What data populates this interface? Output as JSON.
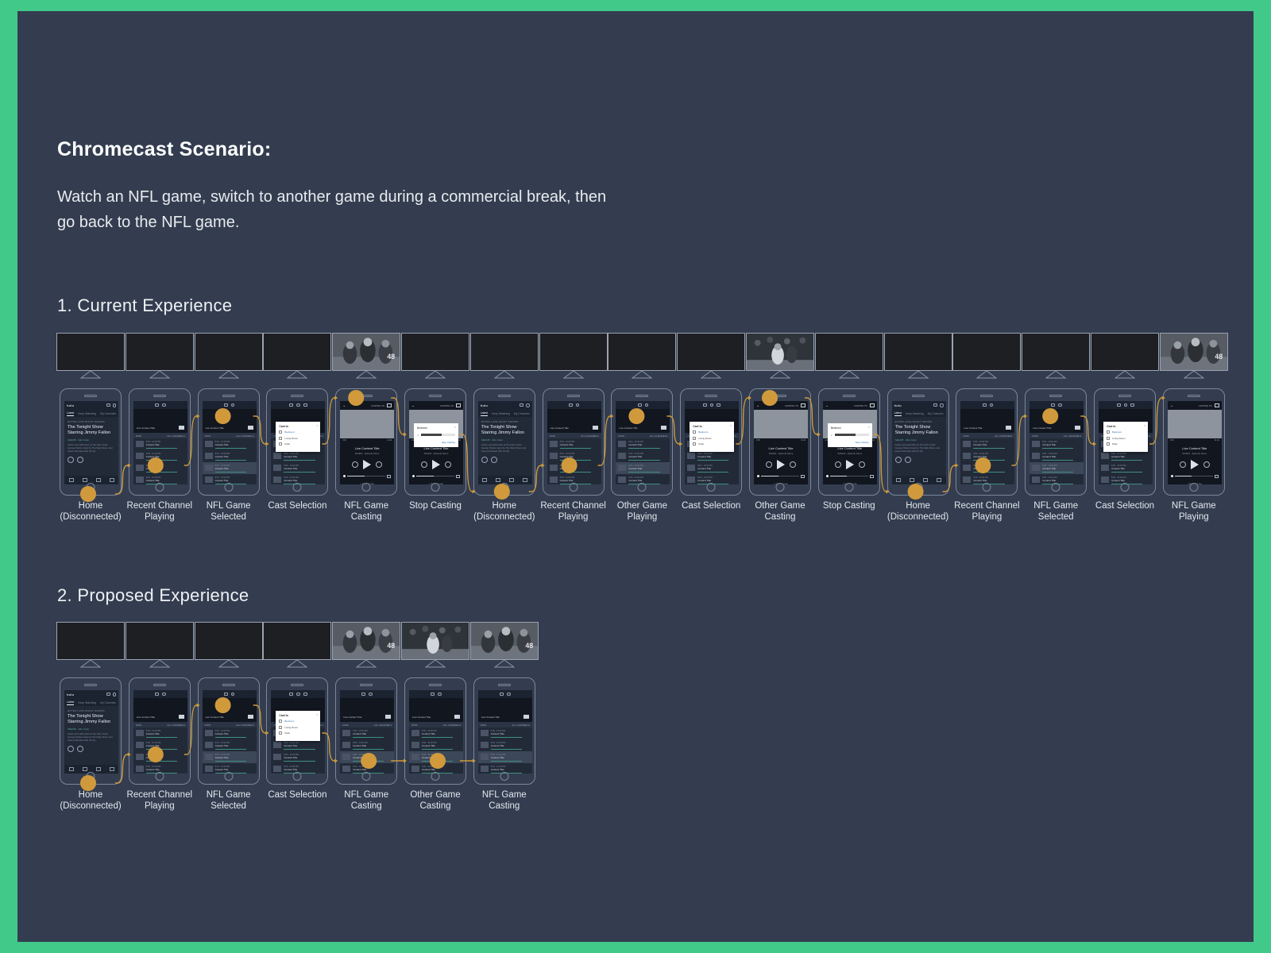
{
  "theme": {
    "frame_color": "#41c98a",
    "background": "#333d4f",
    "accent": "#d09a3c",
    "text": "#e3e8ef",
    "tv_screen": "#1e1f23",
    "device_outline": "#7b879a"
  },
  "header": {
    "title": "Chromecast Scenario:",
    "description": "Watch an NFL game, switch to  another game during a commercial break, then go back to the NFL game."
  },
  "sections": [
    {
      "heading": "1. Current Experience",
      "steps": [
        {
          "caption": "Home\n(Disconnected)",
          "tv": "off",
          "screen": "hulu-home"
        },
        {
          "caption": "Recent Channel\nPlaying",
          "tv": "off",
          "screen": "channel-list"
        },
        {
          "caption": "NFL Game\nSelected",
          "tv": "off",
          "screen": "channel-list-hl"
        },
        {
          "caption": "Cast Selection",
          "tv": "off",
          "screen": "cast-modal"
        },
        {
          "caption": "NFL Game\nCasting",
          "tv": "nfl",
          "screen": "player"
        },
        {
          "caption": "Stop Casting",
          "tv": "off",
          "screen": "stop-modal"
        },
        {
          "caption": "Home\n(Disconnected)",
          "tv": "off",
          "screen": "hulu-home"
        },
        {
          "caption": "Recent Channel\nPlaying",
          "tv": "off",
          "screen": "channel-list"
        },
        {
          "caption": "Other Game\nPlaying",
          "tv": "off",
          "screen": "channel-list-hl"
        },
        {
          "caption": "Cast Selection",
          "tv": "off",
          "screen": "cast-modal"
        },
        {
          "caption": "Other Game\nCasting",
          "tv": "bball",
          "screen": "player"
        },
        {
          "caption": "Stop Casting",
          "tv": "off",
          "screen": "stop-modal"
        },
        {
          "caption": "Home\n(Disconnected)",
          "tv": "off",
          "screen": "hulu-home"
        },
        {
          "caption": "Recent Channel\nPlaying",
          "tv": "off",
          "screen": "channel-list"
        },
        {
          "caption": "NFL Game\nSelected",
          "tv": "off",
          "screen": "channel-list-hl"
        },
        {
          "caption": "Cast Selection",
          "tv": "off",
          "screen": "cast-modal"
        },
        {
          "caption": "NFL Game\nPlaying",
          "tv": "nfl",
          "screen": "player"
        }
      ]
    },
    {
      "heading": "2. Proposed Experience",
      "steps": [
        {
          "caption": "Home\n(Disconnected)",
          "tv": "off",
          "screen": "hulu-home"
        },
        {
          "caption": "Recent Channel\nPlaying",
          "tv": "off",
          "screen": "channel-list"
        },
        {
          "caption": "NFL Game\nSelected",
          "tv": "off",
          "screen": "channel-list-hl"
        },
        {
          "caption": "Cast Selection",
          "tv": "off",
          "screen": "cast-modal"
        },
        {
          "caption": "NFL Game\nCasting",
          "tv": "nfl",
          "screen": "channel-list-hl"
        },
        {
          "caption": "Other Game\nCasting",
          "tv": "bball",
          "screen": "channel-list-hl"
        },
        {
          "caption": "NFL Game\nCasting",
          "tv": "nfl",
          "screen": "channel-list-hl"
        }
      ]
    }
  ],
  "phone_screens": {
    "hulu_home": {
      "logo": "hulu",
      "tabs": [
        "Latest",
        "Keep Watching",
        "My Channels"
      ],
      "kicker": "EXTRA LATE NIGHT SHOWS",
      "title": "The Tonight Show Starring Jimmy Fallon",
      "meta": "S2E135 · 44m Color",
      "description": "Author and staff writer at The New Yorker George Packer stops by The Daily Show, and travel enthusiast with his trip."
    },
    "channel_list": {
      "now_label": "NOW",
      "all_channels_label": "ALL CHANNELS",
      "pip_title": "Live Content Title",
      "row_time": "8:00 - 10:30 PM",
      "row_title": "Content Title"
    },
    "player": {
      "back_icon": "chevron-down-icon",
      "casting_to": "CASTING TO",
      "title": "Live Content Title",
      "subtitle": "S01E01 - Episode Name",
      "jump_label": "Jump to Live",
      "time_start": "0:00",
      "time_end": "11:44"
    },
    "cast_modal": {
      "title": "Cast to",
      "options": [
        "Bedroom",
        "Living Room",
        "Patio"
      ],
      "selected": "Bedroom",
      "close_icon": "close-icon"
    },
    "stop_modal": {
      "device": "Bedroom",
      "volume_icon": "volume-icon",
      "action": "Stop Casting",
      "close_icon": "close-icon"
    }
  }
}
